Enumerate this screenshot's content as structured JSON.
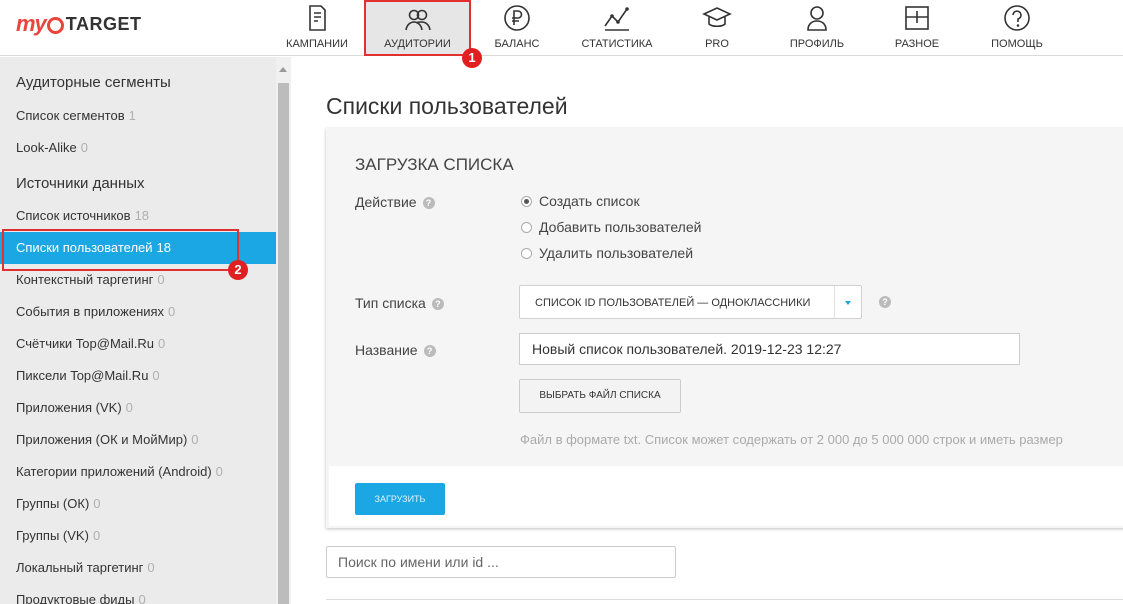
{
  "logo": {
    "my": "my",
    "target": "TARGET"
  },
  "nav": {
    "items": [
      {
        "label": "Кампании",
        "icon": "document-icon"
      },
      {
        "label": "Аудитории",
        "icon": "users-icon"
      },
      {
        "label": "Баланс",
        "icon": "ruble-icon"
      },
      {
        "label": "Статистика",
        "icon": "chart-line-icon"
      },
      {
        "label": "PRO",
        "icon": "graduation-cap-icon"
      },
      {
        "label": "Профиль",
        "icon": "user-icon"
      },
      {
        "label": "Разное",
        "icon": "grid-box-icon"
      },
      {
        "label": "Помощь",
        "icon": "question-icon"
      }
    ],
    "active": "Аудитории"
  },
  "markers": {
    "one": "1",
    "two": "2"
  },
  "sidebar": {
    "section1": "Аудиторные сегменты",
    "section2": "Источники данных",
    "items": [
      {
        "label": "Список сегментов",
        "count": "1"
      },
      {
        "label": "Look-Alike",
        "count": "0"
      },
      {
        "label": "Список источников",
        "count": "18"
      },
      {
        "label": "Списки пользователей",
        "count": "18"
      },
      {
        "label": "Контекстный таргетинг",
        "count": "0"
      },
      {
        "label": "События в приложениях",
        "count": "0"
      },
      {
        "label": "Счётчики Top@Mail.Ru",
        "count": "0"
      },
      {
        "label": "Пиксели Top@Mail.Ru",
        "count": "0"
      },
      {
        "label": "Приложения (VK)",
        "count": "0"
      },
      {
        "label": "Приложения (ОК и МойМир)",
        "count": "0"
      },
      {
        "label": "Категории приложений (Android)",
        "count": "0"
      },
      {
        "label": "Группы (ОК)",
        "count": "0"
      },
      {
        "label": "Группы (VK)",
        "count": "0"
      },
      {
        "label": "Локальный таргетинг",
        "count": "0"
      },
      {
        "label": "Продуктовые фиды",
        "count": "0"
      }
    ],
    "active_index": 3
  },
  "main": {
    "page_title": "Списки пользователей",
    "panel_title": "ЗАГРУЗКА СПИСКА",
    "action_label": "Действие",
    "radios": [
      {
        "label": "Создать список",
        "checked": true
      },
      {
        "label": "Добавить пользователей",
        "checked": false
      },
      {
        "label": "Удалить пользователей",
        "checked": false
      }
    ],
    "type_label": "Тип списка",
    "type_value": "Список ID пользователей — Одноклассники",
    "name_label": "Название",
    "name_value": "Новый список пользователей. 2019-12-23 12:27",
    "file_button": "ВЫБРАТЬ ФАЙЛ СПИСКА",
    "hint": "Файл в формате txt. Список может содержать от 2 000 до 5 000 000 строк и иметь размер",
    "upload_button": "ЗАГРУЗИТЬ",
    "search_placeholder": "Поиск по имени или id ..."
  },
  "colors": {
    "accent": "#1ba7e3",
    "highlight": "#e03030",
    "logo_red": "#e8453c"
  }
}
